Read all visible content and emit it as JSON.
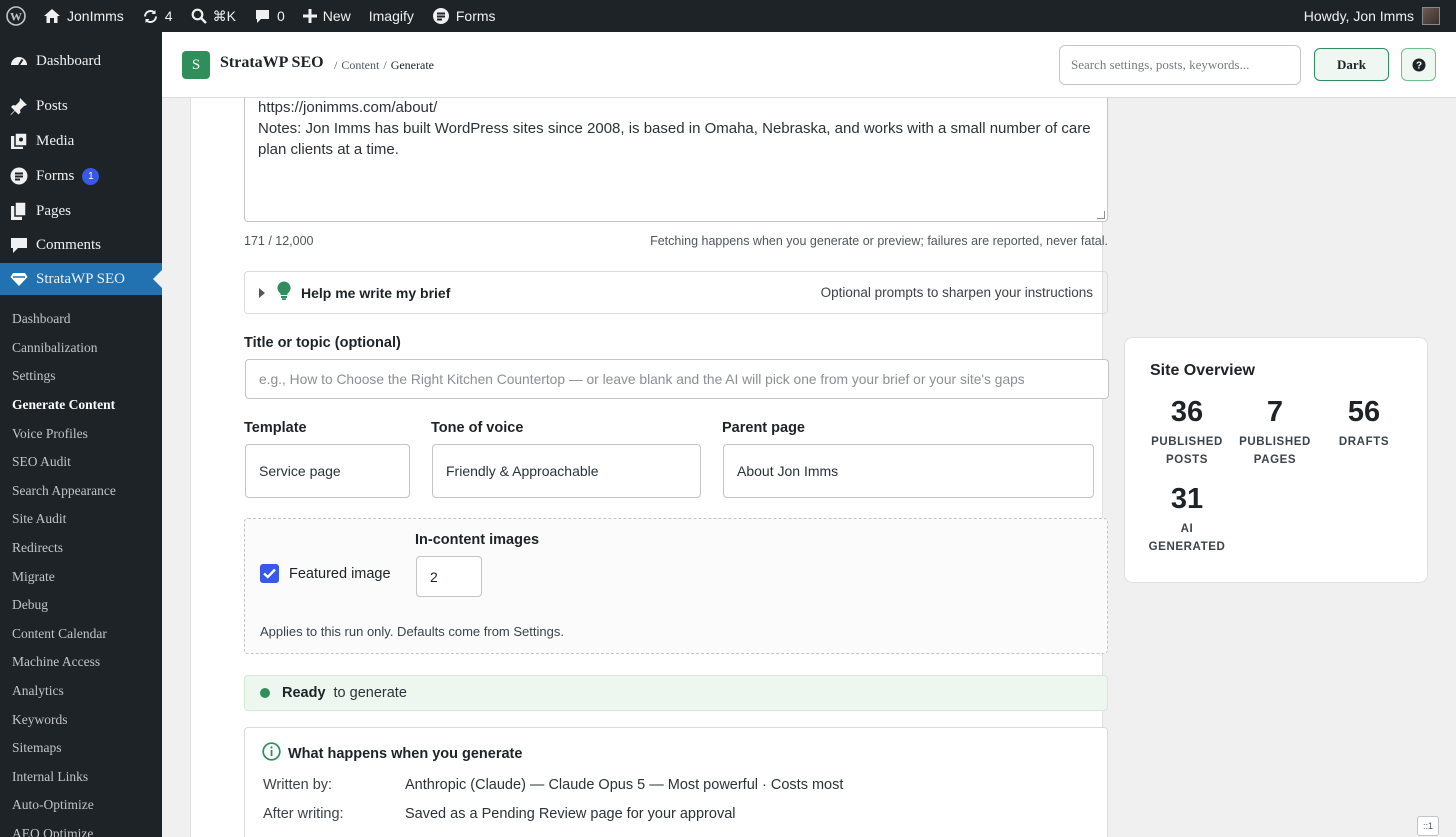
{
  "adminbar": {
    "site_name": "JonImms",
    "updates_count": "4",
    "search_shortcut": "⌘K",
    "comments_count": "0",
    "new_label": "New",
    "imagify_label": "Imagify",
    "forms_label": "Forms",
    "greeting": "Howdy, Jon Imms"
  },
  "sidebar": {
    "dashboard": "Dashboard",
    "posts": "Posts",
    "media": "Media",
    "forms": "Forms",
    "forms_badge": "1",
    "pages": "Pages",
    "comments": "Comments",
    "plugin": "StrataWP SEO",
    "submenu": [
      "Dashboard",
      "Cannibalization",
      "Settings",
      "Generate Content",
      "Voice Profiles",
      "SEO Audit",
      "Search Appearance",
      "Site Audit",
      "Redirects",
      "Migrate",
      "Debug",
      "Content Calendar",
      "Machine Access",
      "Analytics",
      "Keywords",
      "Sitemaps",
      "Internal Links",
      "Auto-Optimize",
      "AEO Optimize"
    ],
    "active_submenu": "Generate Content"
  },
  "header": {
    "logo_letter": "S",
    "title": "StrataWP SEO",
    "crumb_sep": "/",
    "crumb_1": "Content",
    "crumb_2": "Generate",
    "search_placeholder": "Search settings, posts, keywords...",
    "dark_label": "Dark",
    "help_label": "?"
  },
  "brief": {
    "line1": "https://jonimms.com/about/",
    "line2": "Notes: Jon Imms has built WordPress sites since 2008, is based in Omaha, Nebraska, and works with a small number of care plan clients at a time.",
    "char_count": "171 / 12,000",
    "fetch_note": "Fetching happens when you generate or preview; failures are reported, never fatal."
  },
  "helper": {
    "title": "Help me write my brief",
    "note": "Optional prompts to sharpen your instructions"
  },
  "form": {
    "title_label": "Title or topic (optional)",
    "title_placeholder": "e.g., How to Choose the Right Kitchen Countertop — or leave blank and the AI will pick one from your brief or your site's gaps",
    "template_label": "Template",
    "template_value": "Service page",
    "tone_label": "Tone of voice",
    "tone_value": "Friendly & Approachable",
    "parent_label": "Parent page",
    "parent_value": "About Jon Imms"
  },
  "images": {
    "featured_label": "Featured image",
    "featured_checked": true,
    "incontent_label": "In-content images",
    "incontent_value": "2",
    "note": "Applies to this run only. Defaults come from Settings."
  },
  "status": {
    "ready_strong": "Ready",
    "ready_rest": "to generate"
  },
  "what_happens": {
    "title": "What happens when you generate",
    "written_by_key": "Written by:",
    "written_by_value": "Anthropic (Claude) — Claude Opus 5 — Most powerful · Costs most",
    "after_key": "After writing:",
    "after_value": "Saved as a Pending Review page for your approval"
  },
  "overview": {
    "title": "Site Overview",
    "stats": [
      {
        "num": "36",
        "label_1": "Published",
        "label_2": "Posts"
      },
      {
        "num": "7",
        "label_1": "Published",
        "label_2": "Pages"
      },
      {
        "num": "56",
        "label_1": "Drafts",
        "label_2": ""
      },
      {
        "num": "31",
        "label_1": "AI",
        "label_2": "Generated"
      }
    ]
  },
  "corner_tag": "::1",
  "colors": {
    "admin_dark": "#1d2327",
    "wp_blue": "#2271b1",
    "brand_green": "#2f8f5b",
    "checkbox_blue": "#3858e9"
  }
}
